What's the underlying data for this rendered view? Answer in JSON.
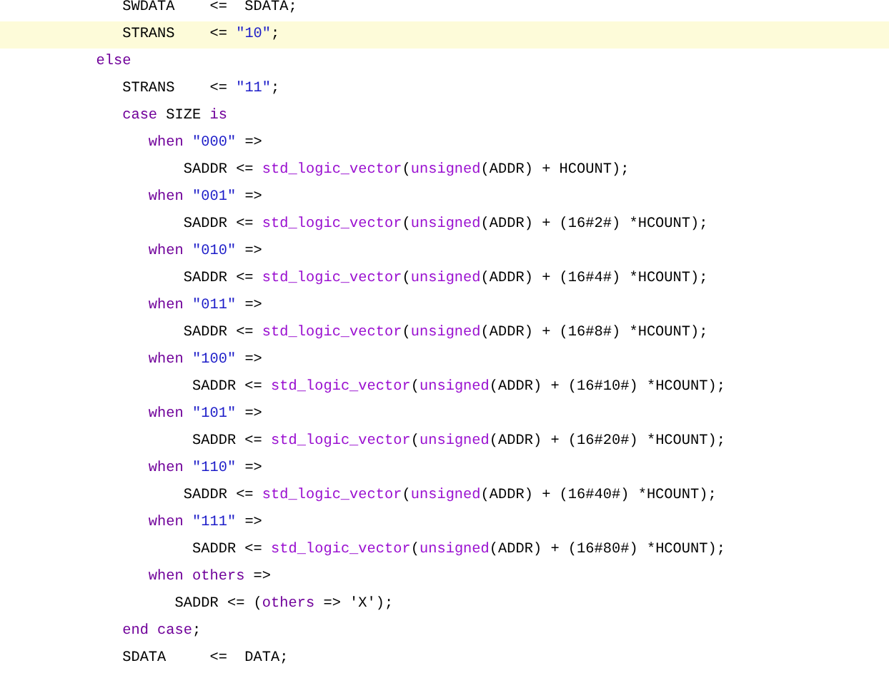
{
  "editor": {
    "lines": [
      {
        "highlighted": false,
        "tokens": [
          {
            "kind": "plain",
            "text": "              SWDATA    <=  SDATA;"
          }
        ]
      },
      {
        "highlighted": true,
        "tokens": [
          {
            "kind": "plain",
            "text": "              STRANS    <= "
          },
          {
            "kind": "string",
            "text": "\"10\""
          },
          {
            "kind": "plain",
            "text": ";"
          }
        ]
      },
      {
        "highlighted": false,
        "tokens": [
          {
            "kind": "keyword",
            "text": "           else"
          }
        ]
      },
      {
        "highlighted": false,
        "tokens": [
          {
            "kind": "plain",
            "text": "              STRANS    <= "
          },
          {
            "kind": "string",
            "text": "\"11\""
          },
          {
            "kind": "plain",
            "text": ";"
          }
        ]
      },
      {
        "highlighted": false,
        "tokens": [
          {
            "kind": "keyword",
            "text": "              case"
          },
          {
            "kind": "plain",
            "text": " SIZE "
          },
          {
            "kind": "keyword",
            "text": "is"
          }
        ]
      },
      {
        "highlighted": false,
        "tokens": [
          {
            "kind": "keyword",
            "text": "                 when"
          },
          {
            "kind": "string",
            "text": " \"000\""
          },
          {
            "kind": "plain",
            "text": " =>"
          }
        ]
      },
      {
        "highlighted": false,
        "tokens": [
          {
            "kind": "plain",
            "text": "                     SADDR <= "
          },
          {
            "kind": "function",
            "text": "std_logic_vector"
          },
          {
            "kind": "plain",
            "text": "("
          },
          {
            "kind": "function",
            "text": "unsigned"
          },
          {
            "kind": "plain",
            "text": "(ADDR) + HCOUNT);"
          }
        ]
      },
      {
        "highlighted": false,
        "tokens": [
          {
            "kind": "keyword",
            "text": "                 when"
          },
          {
            "kind": "string",
            "text": " \"001\""
          },
          {
            "kind": "plain",
            "text": " =>"
          }
        ]
      },
      {
        "highlighted": false,
        "tokens": [
          {
            "kind": "plain",
            "text": "                     SADDR <= "
          },
          {
            "kind": "function",
            "text": "std_logic_vector"
          },
          {
            "kind": "plain",
            "text": "("
          },
          {
            "kind": "function",
            "text": "unsigned"
          },
          {
            "kind": "plain",
            "text": "(ADDR) + (16#2#) *HCOUNT);"
          }
        ]
      },
      {
        "highlighted": false,
        "tokens": [
          {
            "kind": "keyword",
            "text": "                 when"
          },
          {
            "kind": "string",
            "text": " \"010\""
          },
          {
            "kind": "plain",
            "text": " =>"
          }
        ]
      },
      {
        "highlighted": false,
        "tokens": [
          {
            "kind": "plain",
            "text": "                     SADDR <= "
          },
          {
            "kind": "function",
            "text": "std_logic_vector"
          },
          {
            "kind": "plain",
            "text": "("
          },
          {
            "kind": "function",
            "text": "unsigned"
          },
          {
            "kind": "plain",
            "text": "(ADDR) + (16#4#) *HCOUNT);"
          }
        ]
      },
      {
        "highlighted": false,
        "tokens": [
          {
            "kind": "keyword",
            "text": "                 when"
          },
          {
            "kind": "string",
            "text": " \"011\""
          },
          {
            "kind": "plain",
            "text": " =>"
          }
        ]
      },
      {
        "highlighted": false,
        "tokens": [
          {
            "kind": "plain",
            "text": "                     SADDR <= "
          },
          {
            "kind": "function",
            "text": "std_logic_vector"
          },
          {
            "kind": "plain",
            "text": "("
          },
          {
            "kind": "function",
            "text": "unsigned"
          },
          {
            "kind": "plain",
            "text": "(ADDR) + (16#8#) *HCOUNT);"
          }
        ]
      },
      {
        "highlighted": false,
        "tokens": [
          {
            "kind": "keyword",
            "text": "                 when"
          },
          {
            "kind": "string",
            "text": " \"100\""
          },
          {
            "kind": "plain",
            "text": " =>"
          }
        ]
      },
      {
        "highlighted": false,
        "tokens": [
          {
            "kind": "plain",
            "text": "                      SADDR <= "
          },
          {
            "kind": "function",
            "text": "std_logic_vector"
          },
          {
            "kind": "plain",
            "text": "("
          },
          {
            "kind": "function",
            "text": "unsigned"
          },
          {
            "kind": "plain",
            "text": "(ADDR) + (16#10#) *HCOUNT);"
          }
        ]
      },
      {
        "highlighted": false,
        "tokens": [
          {
            "kind": "keyword",
            "text": "                 when"
          },
          {
            "kind": "string",
            "text": " \"101\""
          },
          {
            "kind": "plain",
            "text": " =>"
          }
        ]
      },
      {
        "highlighted": false,
        "tokens": [
          {
            "kind": "plain",
            "text": "                      SADDR <= "
          },
          {
            "kind": "function",
            "text": "std_logic_vector"
          },
          {
            "kind": "plain",
            "text": "("
          },
          {
            "kind": "function",
            "text": "unsigned"
          },
          {
            "kind": "plain",
            "text": "(ADDR) + (16#20#) *HCOUNT);"
          }
        ]
      },
      {
        "highlighted": false,
        "tokens": [
          {
            "kind": "keyword",
            "text": "                 when"
          },
          {
            "kind": "string",
            "text": " \"110\""
          },
          {
            "kind": "plain",
            "text": " =>"
          }
        ]
      },
      {
        "highlighted": false,
        "tokens": [
          {
            "kind": "plain",
            "text": "                     SADDR <= "
          },
          {
            "kind": "function",
            "text": "std_logic_vector"
          },
          {
            "kind": "plain",
            "text": "("
          },
          {
            "kind": "function",
            "text": "unsigned"
          },
          {
            "kind": "plain",
            "text": "(ADDR) + (16#40#) *HCOUNT);"
          }
        ]
      },
      {
        "highlighted": false,
        "tokens": [
          {
            "kind": "keyword",
            "text": "                 when"
          },
          {
            "kind": "string",
            "text": " \"111\""
          },
          {
            "kind": "plain",
            "text": " =>"
          }
        ]
      },
      {
        "highlighted": false,
        "tokens": [
          {
            "kind": "plain",
            "text": "                      SADDR <= "
          },
          {
            "kind": "function",
            "text": "std_logic_vector"
          },
          {
            "kind": "plain",
            "text": "("
          },
          {
            "kind": "function",
            "text": "unsigned"
          },
          {
            "kind": "plain",
            "text": "(ADDR) + (16#80#) *HCOUNT);"
          }
        ]
      },
      {
        "highlighted": false,
        "tokens": [
          {
            "kind": "keyword",
            "text": "                 when others"
          },
          {
            "kind": "plain",
            "text": " =>"
          }
        ]
      },
      {
        "highlighted": false,
        "tokens": [
          {
            "kind": "plain",
            "text": "                    SADDR <= ("
          },
          {
            "kind": "keyword",
            "text": "others"
          },
          {
            "kind": "plain",
            "text": " => 'X');"
          }
        ]
      },
      {
        "highlighted": false,
        "tokens": [
          {
            "kind": "keyword",
            "text": "              end case"
          },
          {
            "kind": "plain",
            "text": ";"
          }
        ]
      },
      {
        "highlighted": false,
        "tokens": [
          {
            "kind": "plain",
            "text": "              SDATA     <=  DATA;"
          }
        ]
      }
    ]
  }
}
